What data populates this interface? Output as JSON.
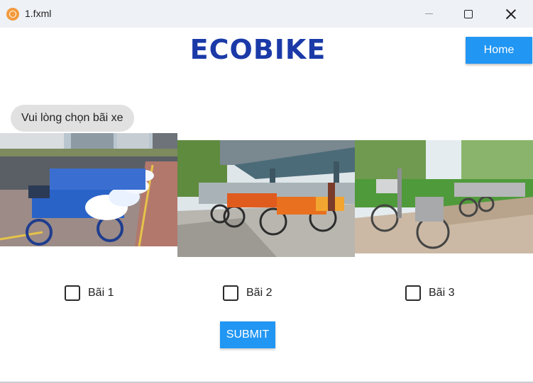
{
  "window": {
    "title": "1.fxml",
    "icon": "app-icon"
  },
  "header": {
    "title": "ECOBIKE",
    "home_label": "Home"
  },
  "prompt": "Vui lòng chọn bãi xe",
  "choices": [
    {
      "label": "Bãi 1",
      "checked": false
    },
    {
      "label": "Bãi 2",
      "checked": false
    },
    {
      "label": "Bãi 3",
      "checked": false
    }
  ],
  "submit_label": "SUBMIT",
  "colors": {
    "accent": "#2196f3",
    "brand": "#1b3aa8"
  }
}
